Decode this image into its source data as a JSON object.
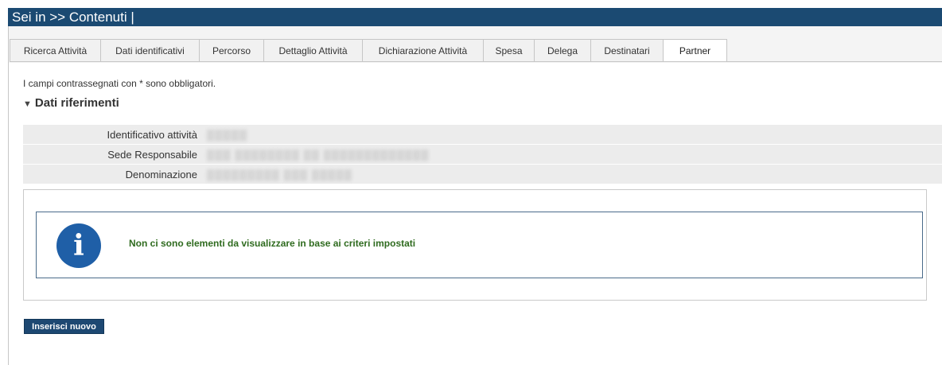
{
  "header": {
    "title": "Sei in >> Contenuti |"
  },
  "tabs": [
    {
      "label": "Ricerca Attività"
    },
    {
      "label": "Dati identificativi"
    },
    {
      "label": "Percorso"
    },
    {
      "label": "Dettaglio Attività"
    },
    {
      "label": "Dichiarazione Attività"
    },
    {
      "label": "Spesa"
    },
    {
      "label": "Delega"
    },
    {
      "label": "Destinatari"
    },
    {
      "label": "Partner",
      "active": true
    }
  ],
  "required_note": "I campi contrassegnati con * sono obbligatori.",
  "section": {
    "title": "Dati riferimenti"
  },
  "fields": [
    {
      "label": "Identificativo attività",
      "value": "▒▒▒▒▒"
    },
    {
      "label": "Sede Responsabile",
      "value": "▒▒▒ ▒▒▒▒▒▒▒▒ ▒▒ ▒▒▒▒▒▒▒▒▒▒▒▒▒"
    },
    {
      "label": "Denominazione",
      "value": "▒▒▒▒▒▒▒▒▒ ▒▒▒ ▒▒▒▒▒"
    }
  ],
  "notice": {
    "icon": "info-icon",
    "message": "Non ci sono elementi da visualizzare in base ai criteri impostati"
  },
  "actions": {
    "insert_label": "Inserisci nuovo"
  }
}
